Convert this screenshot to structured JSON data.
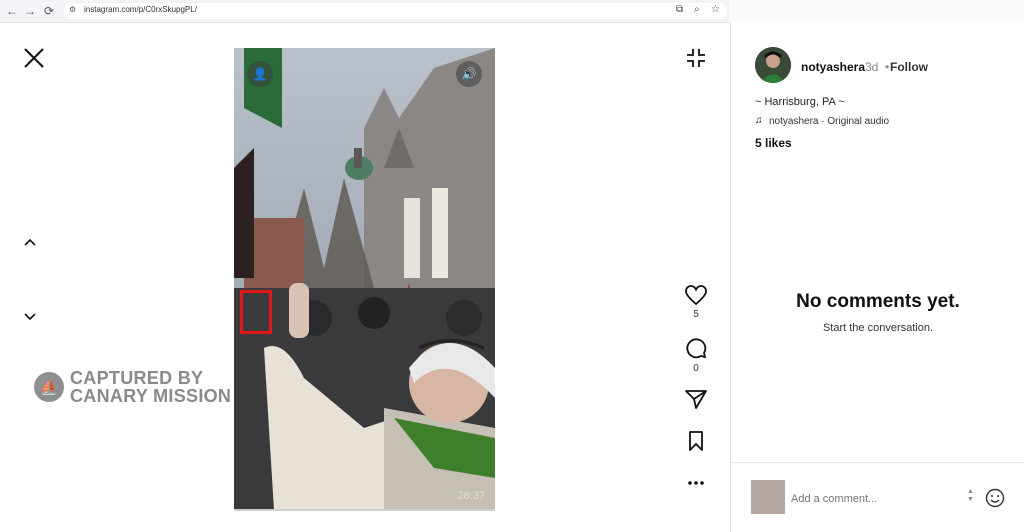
{
  "browser": {
    "back": "←",
    "forward": "→",
    "reload": "⟳",
    "url": "instagram.com/p/C0rxSkupgPL/"
  },
  "watermark": {
    "line1": "CAPTURED BY",
    "line2": "CANARY MISSION"
  },
  "video": {
    "timestamp": "28:37"
  },
  "actions": {
    "likes_count": "5",
    "comments_count": "0"
  },
  "post": {
    "username": "notyashera",
    "time": "3d",
    "separator": "•",
    "follow": "Follow",
    "location": "~ Harrisburg, PA ~",
    "audio": "notyashera · Original audio",
    "likes": "5 likes"
  },
  "comments": {
    "empty_title": "No comments yet.",
    "empty_subtitle": "Start the conversation.",
    "placeholder": "Add a comment..."
  }
}
